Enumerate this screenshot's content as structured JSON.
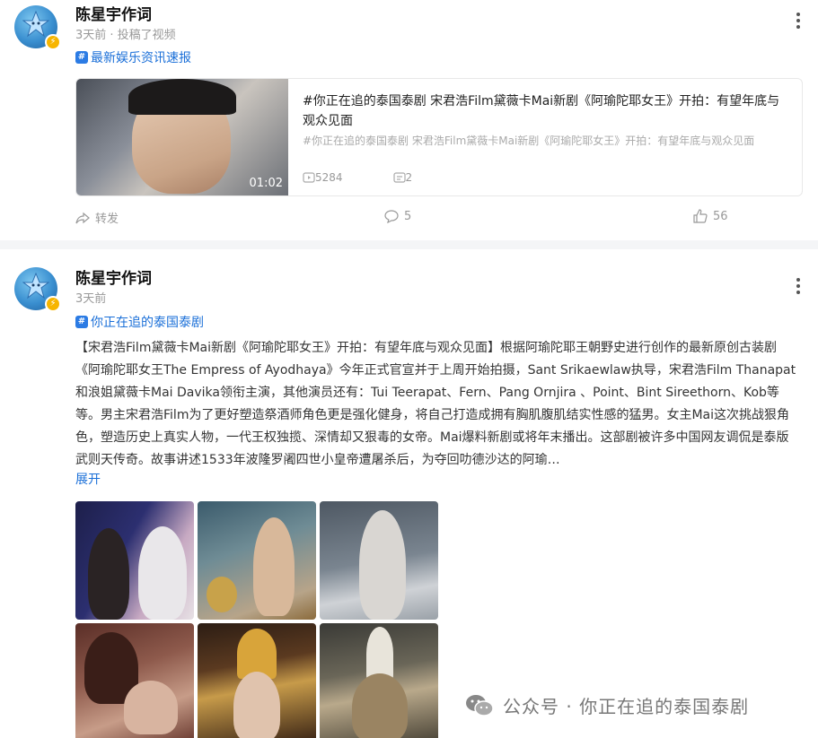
{
  "post1": {
    "author": "陈星宇作词",
    "meta": "3天前 · 投稿了视频",
    "topic": "最新娱乐资讯速报",
    "video": {
      "duration": "01:02",
      "title": "#你正在追的泰国泰剧 宋君浩Film黛薇卡Mai新剧《阿瑜陀耶女王》开拍：有望年底与观众见面",
      "subtitle": "#你正在追的泰国泰剧 宋君浩Film黛薇卡Mai新剧《阿瑜陀耶女王》开拍：有望年底与观众见面",
      "plays": "5284",
      "comments": "2"
    },
    "actions": {
      "share": "转发",
      "comment": "5",
      "like": "56"
    }
  },
  "post2": {
    "author": "陈星宇作词",
    "meta": "3天前",
    "topic": "你正在追的泰国泰剧",
    "body": "【宋君浩Film黛薇卡Mai新剧《阿瑜陀耶女王》开拍：有望年底与观众见面】根据阿瑜陀耶王朝野史进行创作的最新原创古装剧《阿瑜陀耶女王The Empress of Ayodhaya》今年正式官宣并于上周开始拍摄，Sant Srikaewlaw执导，宋君浩Film Thanapat和浪姐黛薇卡Mai Davika领衔主演，其他演员还有：Tui Teerapat、Fern、Pang Ornjira 、Point、Bint Sireethorn、Kob等等。男主宋君浩Film为了更好塑造祭酒师角色更是强化健身，将自己打造成拥有胸肌腹肌结实性感的猛男。女主Mai这次挑战狠角色，塑造历史上真实人物，一代王权独揽、深情却又狠毒的女帝。Mai爆料新剧或将年末播出。这部剧被许多中国网友调侃是泰版武则天传奇。故事讲述1533年波隆罗阇四世小皇帝遭屠杀后，为夺回叻德沙达的阿瑜…",
    "expand": "展开"
  },
  "watermark": "公众号 · 你正在追的泰国泰剧",
  "colors": {
    "link": "#1a6fd8",
    "muted": "#999999",
    "separator": "#f4f5f7",
    "badge": "#f7b500"
  }
}
